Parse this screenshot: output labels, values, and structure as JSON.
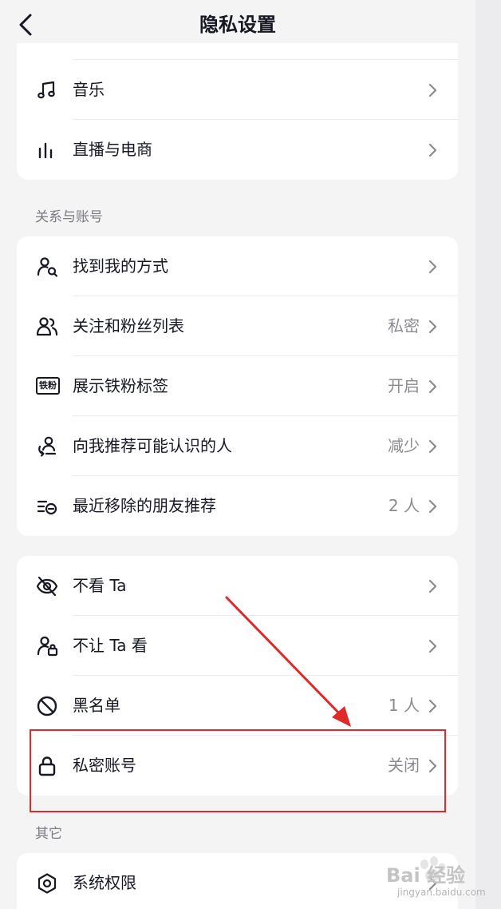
{
  "header": {
    "title": "隐私设置"
  },
  "card_media": {
    "rows": [
      {
        "icon": "music-note-icon",
        "label": "音乐",
        "value": ""
      },
      {
        "icon": "live-bars-icon",
        "label": "直播与电商",
        "value": ""
      }
    ]
  },
  "section_relations": {
    "title": "关系与账号"
  },
  "card_relations": {
    "rows": [
      {
        "icon": "find-me-icon",
        "label": "找到我的方式",
        "value": ""
      },
      {
        "icon": "followers-icon",
        "label": "关注和粉丝列表",
        "value": "私密"
      },
      {
        "icon": "iron-fan-badge-icon",
        "label": "展示铁粉标签",
        "value": "开启",
        "badge_text": "铁粉"
      },
      {
        "icon": "recommend-people-icon",
        "label": "向我推荐可能认识的人",
        "value": "减少"
      },
      {
        "icon": "removed-list-icon",
        "label": "最近移除的朋友推荐",
        "value": "2 人"
      }
    ]
  },
  "card_blocking": {
    "rows": [
      {
        "icon": "eye-off-icon",
        "label": "不看 Ta",
        "value": ""
      },
      {
        "icon": "user-lock-icon",
        "label": "不让 Ta 看",
        "value": ""
      },
      {
        "icon": "block-icon",
        "label": "黑名单",
        "value": "1 人"
      },
      {
        "icon": "lock-icon",
        "label": "私密账号",
        "value": "关闭"
      }
    ]
  },
  "section_other": {
    "title": "其它"
  },
  "card_other": {
    "rows": [
      {
        "icon": "hexagon-settings-icon",
        "label": "系统权限",
        "value": ""
      }
    ]
  },
  "watermark": {
    "brand": "Bai 经验",
    "site": "jingyan.baidu.com"
  },
  "colors": {
    "accent_red": "#e02a2a",
    "text": "#161823",
    "secondary": "#8a8b91",
    "background": "#f4f4f5"
  }
}
